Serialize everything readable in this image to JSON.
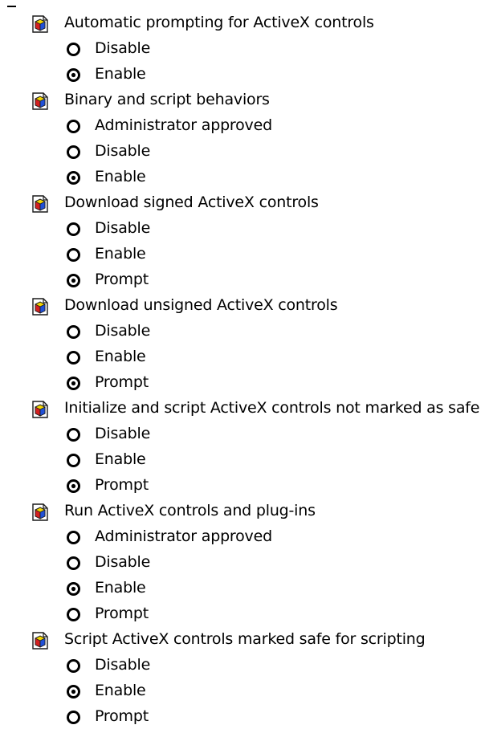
{
  "settings": [
    {
      "label": "Automatic prompting for ActiveX controls",
      "icon": "settings-page-icon",
      "options": [
        {
          "label": "Disable",
          "selected": false
        },
        {
          "label": "Enable",
          "selected": true
        }
      ]
    },
    {
      "label": "Binary and script behaviors",
      "icon": "settings-page-icon",
      "options": [
        {
          "label": "Administrator approved",
          "selected": false
        },
        {
          "label": "Disable",
          "selected": false
        },
        {
          "label": "Enable",
          "selected": true
        }
      ]
    },
    {
      "label": "Download signed ActiveX controls",
      "icon": "settings-page-icon",
      "options": [
        {
          "label": "Disable",
          "selected": false
        },
        {
          "label": "Enable",
          "selected": false
        },
        {
          "label": "Prompt",
          "selected": true
        }
      ]
    },
    {
      "label": "Download unsigned ActiveX controls",
      "icon": "settings-page-icon",
      "options": [
        {
          "label": "Disable",
          "selected": false
        },
        {
          "label": "Enable",
          "selected": false
        },
        {
          "label": "Prompt",
          "selected": true
        }
      ]
    },
    {
      "label": "Initialize and script ActiveX controls not marked as safe",
      "icon": "settings-page-icon",
      "options": [
        {
          "label": "Disable",
          "selected": false
        },
        {
          "label": "Enable",
          "selected": false
        },
        {
          "label": "Prompt",
          "selected": true
        }
      ]
    },
    {
      "label": "Run ActiveX controls and plug-ins",
      "icon": "settings-page-icon",
      "options": [
        {
          "label": "Administrator approved",
          "selected": false
        },
        {
          "label": "Disable",
          "selected": false
        },
        {
          "label": "Enable",
          "selected": true
        },
        {
          "label": "Prompt",
          "selected": false
        }
      ]
    },
    {
      "label": "Script ActiveX controls marked safe for scripting",
      "icon": "settings-page-icon",
      "options": [
        {
          "label": "Disable",
          "selected": false
        },
        {
          "label": "Enable",
          "selected": true
        },
        {
          "label": "Prompt",
          "selected": false
        }
      ]
    }
  ],
  "colors": {
    "icon_border": "#1a1a1a",
    "icon_page": "#ffffff",
    "icon_yellow": "#f2d400",
    "icon_red": "#d42020",
    "icon_blue": "#2050d8",
    "radio_ring": "#000000"
  }
}
